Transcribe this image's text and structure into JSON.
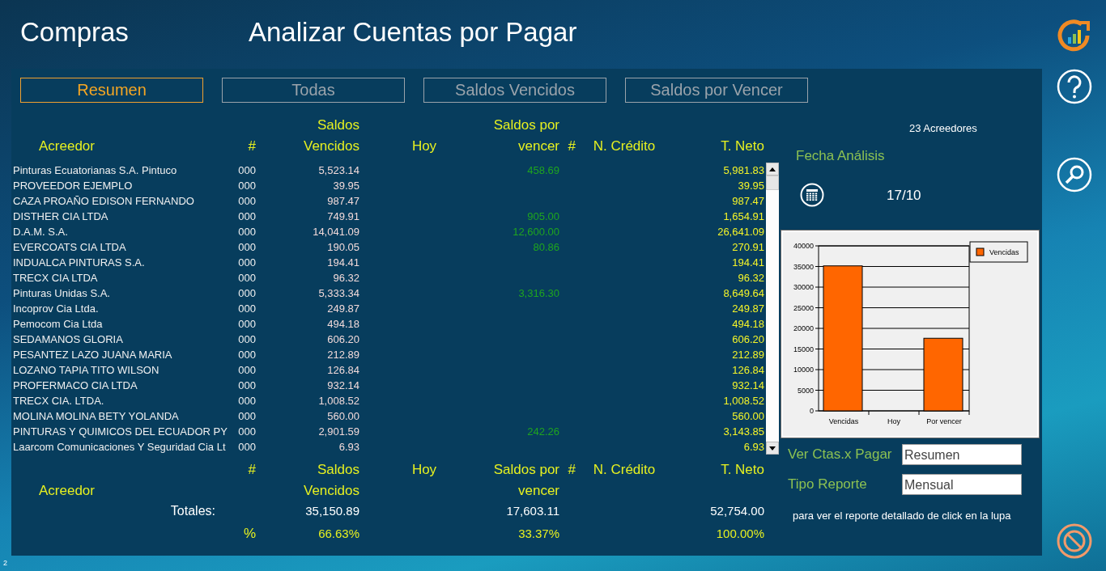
{
  "header": {
    "module": "Compras",
    "title": "Analizar Cuentas por Pagar"
  },
  "tabs": [
    {
      "label": "Resumen",
      "selected": true
    },
    {
      "label": "Todas",
      "selected": false
    },
    {
      "label": "Saldos Vencidos",
      "selected": false
    },
    {
      "label": "Saldos por Vencer",
      "selected": false
    }
  ],
  "table": {
    "columns": [
      "Acreedor",
      "#",
      "Saldos Vencidos",
      "Hoy",
      "Saldos por vencer",
      "#",
      "N. Crédito",
      "T. Neto"
    ],
    "rows": [
      {
        "acreedor": "Pinturas Ecuatorianas S.A. Pintuco",
        "count": "000",
        "vencidos": "5,523.14",
        "por_vencer": "458.69",
        "neto": "5,981.83"
      },
      {
        "acreedor": "PROVEEDOR EJEMPLO",
        "count": "000",
        "vencidos": "39.95",
        "neto": "39.95"
      },
      {
        "acreedor": "CAZA PROAÑO EDISON FERNANDO",
        "count": "000",
        "vencidos": "987.47",
        "neto": "987.47"
      },
      {
        "acreedor": "DISTHER CIA LTDA",
        "count": "000",
        "vencidos": "749.91",
        "por_vencer": "905.00",
        "neto": "1,654.91"
      },
      {
        "acreedor": "D.A.M. S.A.",
        "count": "000",
        "vencidos": "14,041.09",
        "por_vencer": "12,600.00",
        "neto": "26,641.09"
      },
      {
        "acreedor": "EVERCOATS CIA LTDA",
        "count": "000",
        "vencidos": "190.05",
        "por_vencer": "80.86",
        "neto": "270.91"
      },
      {
        "acreedor": "INDUALCA PINTURAS S.A.",
        "count": "000",
        "vencidos": "194.41",
        "neto": "194.41"
      },
      {
        "acreedor": "TRECX CIA LTDA",
        "count": "000",
        "vencidos": "96.32",
        "neto": "96.32"
      },
      {
        "acreedor": "Pinturas Unidas S.A.",
        "count": "000",
        "vencidos": "5,333.34",
        "por_vencer": "3,316.30",
        "neto": "8,649.64"
      },
      {
        "acreedor": "Incoprov Cia Ltda.",
        "count": "000",
        "vencidos": "249.87",
        "neto": "249.87"
      },
      {
        "acreedor": "Pemocom Cia Ltda",
        "count": "000",
        "vencidos": "494.18",
        "neto": "494.18"
      },
      {
        "acreedor": "SEDAMANOS GLORIA",
        "count": "000",
        "vencidos": "606.20",
        "neto": "606.20"
      },
      {
        "acreedor": "PESANTEZ LAZO JUANA MARIA",
        "count": "000",
        "vencidos": "212.89",
        "neto": "212.89"
      },
      {
        "acreedor": "LOZANO TAPIA TITO WILSON",
        "count": "000",
        "vencidos": "126.84",
        "neto": "126.84"
      },
      {
        "acreedor": "PROFERMACO CIA LTDA",
        "count": "000",
        "vencidos": "932.14",
        "neto": "932.14"
      },
      {
        "acreedor": "TRECX CIA. LTDA.",
        "count": "000",
        "vencidos": "1,008.52",
        "neto": "1,008.52"
      },
      {
        "acreedor": "MOLINA MOLINA BETY YOLANDA",
        "count": "000",
        "vencidos": "560.00",
        "neto": "560.00"
      },
      {
        "acreedor": "PINTURAS Y QUIMICOS DEL ECUADOR PY",
        "count": "000",
        "vencidos": "2,901.59",
        "por_vencer": "242.26",
        "neto": "3,143.85"
      },
      {
        "acreedor": "Laarcom Comunicaciones Y Seguridad Cia Lt",
        "count": "000",
        "vencidos": "6.93",
        "neto": "6.93"
      }
    ]
  },
  "totals": {
    "columns": [
      "Acreedor",
      "#",
      "Saldos Vencidos",
      "Hoy",
      "Saldos por vencer",
      "#",
      "N. Crédito",
      "T. Neto"
    ],
    "label": "Totales:",
    "vencidos": "35,150.89",
    "por_vencer": "17,603.11",
    "neto": "52,754.00",
    "percent_label": "%",
    "vencidos_pct": "66.63%",
    "por_vencer_pct": "33.37%",
    "neto_pct": "100.00%"
  },
  "side": {
    "count": "23 Acreedores",
    "date_label": "Fecha Análisis",
    "date": "17/10",
    "chart_data": {
      "type": "bar",
      "grid": true,
      "categories": [
        "Vencidas",
        "Hoy",
        "Por vencer"
      ],
      "series": [
        {
          "name": "Vencidas",
          "color": "#ff6600",
          "values": [
            35150,
            null,
            17600
          ]
        }
      ],
      "ylim": [
        0,
        40000
      ],
      "yticks": [
        0,
        5000,
        10000,
        15000,
        20000,
        25000,
        30000,
        35000,
        40000
      ]
    },
    "fields": [
      {
        "label": "Ver Ctas.x Pagar",
        "value": "Resumen"
      },
      {
        "label": "Tipo Reporte",
        "value": "Mensual"
      }
    ],
    "note": "para ver el reporte detallado de click en la lupa"
  },
  "page_number": "2"
}
